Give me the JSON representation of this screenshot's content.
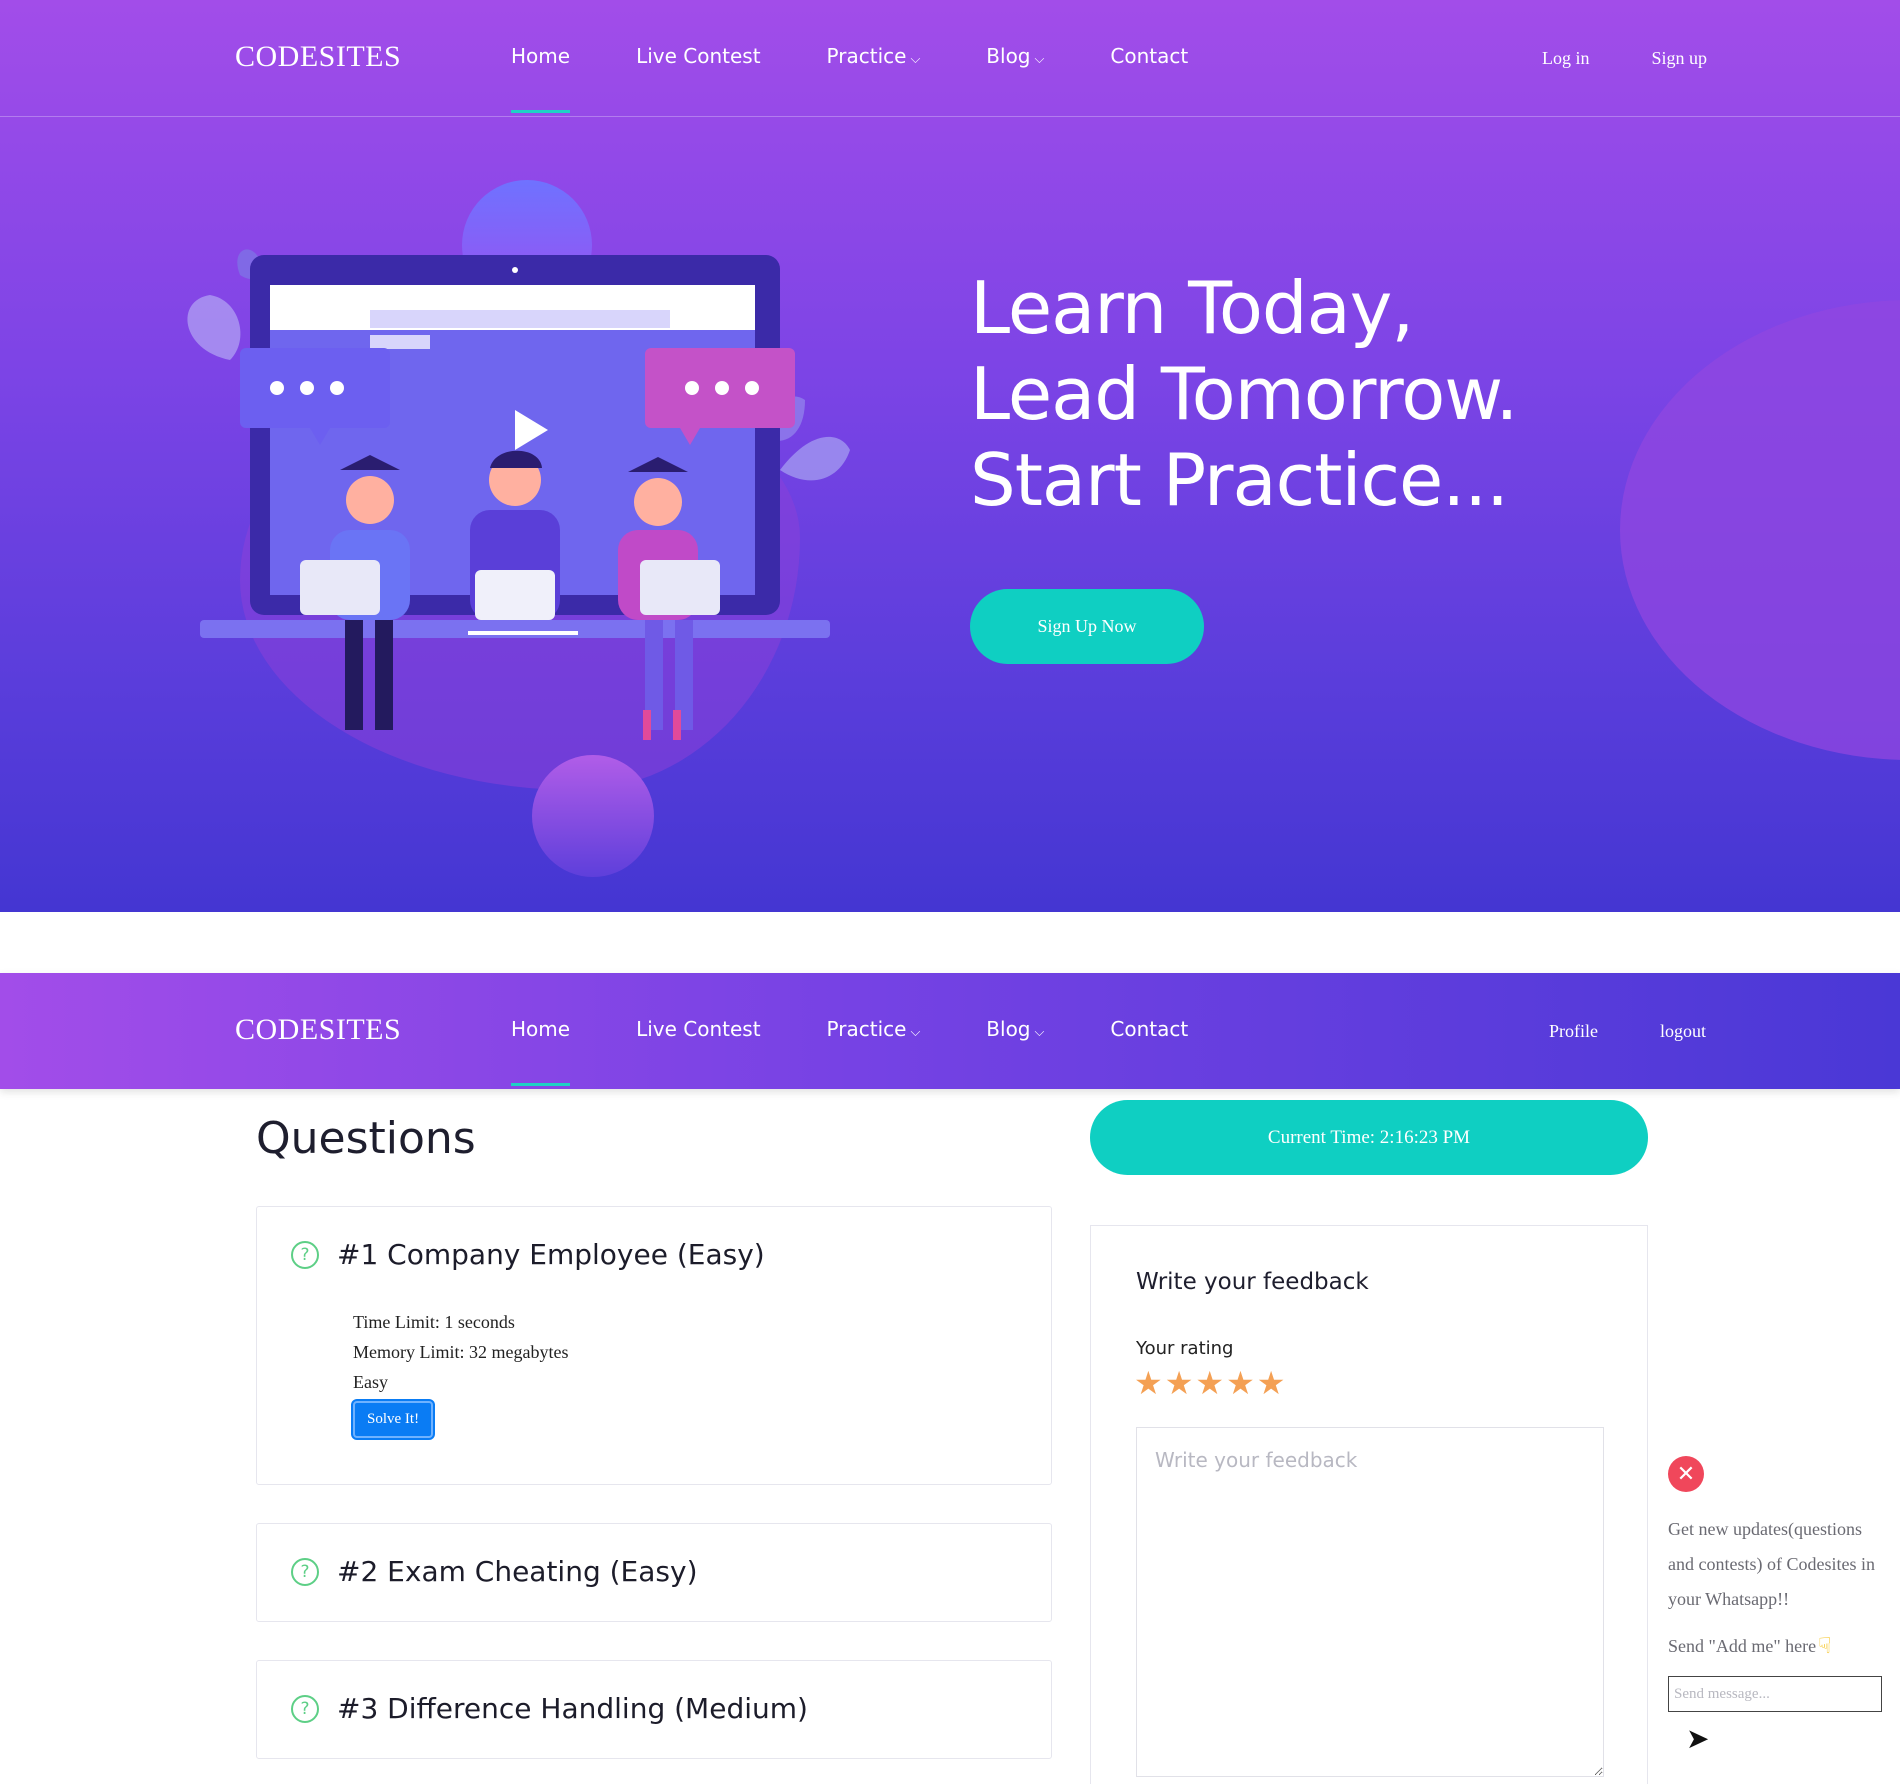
{
  "brand": "CODESITES",
  "nav": {
    "items": [
      {
        "label": "Home",
        "active": true,
        "dropdown": false
      },
      {
        "label": "Live Contest",
        "active": false,
        "dropdown": false
      },
      {
        "label": "Practice",
        "active": false,
        "dropdown": true
      },
      {
        "label": "Blog",
        "active": false,
        "dropdown": true
      },
      {
        "label": "Contact",
        "active": false,
        "dropdown": false
      }
    ],
    "caret": "⌵"
  },
  "hero": {
    "auth": {
      "login": "Log in",
      "signup": "Sign up"
    },
    "headline": [
      "Learn Today,",
      "Lead Tomorrow.",
      "Start Practice..."
    ],
    "cta": "Sign Up Now",
    "colors": {
      "start": "#a24de9",
      "end": "#4436d2",
      "accent": "#0fcfc2"
    }
  },
  "nav2": {
    "auth": {
      "profile": "Profile",
      "logout": "logout"
    }
  },
  "questions": {
    "title": "Questions",
    "icon": "question-circle-icon",
    "items": [
      {
        "name": "#1 Company Employee (Easy)",
        "time_limit": "Time Limit: 1 seconds",
        "memory_limit": "Memory Limit: 32 megabytes",
        "difficulty": "Easy",
        "button": "Solve It!",
        "expanded": true
      },
      {
        "name": "#2 Exam Cheating (Easy)",
        "expanded": false
      },
      {
        "name": "#3 Difference Handling (Medium)",
        "expanded": false
      }
    ]
  },
  "clock": {
    "label": "Current Time: 2:16:23 PM"
  },
  "feedback": {
    "title": "Write your feedback",
    "rating_label": "Your rating",
    "rating": 5,
    "max_rating": 5,
    "placeholder": "Write your feedback",
    "star_color": "#f4a054"
  },
  "whatsapp": {
    "close_icon": "close-icon",
    "text": "Get new updates(questions and contests) of Codesites in your Whatsapp!!",
    "send_label": "Send \"Add me\" here",
    "pointer_icon": "hand-pointing-down-icon",
    "placeholder": "Send message...",
    "send_icon": "send-icon"
  }
}
